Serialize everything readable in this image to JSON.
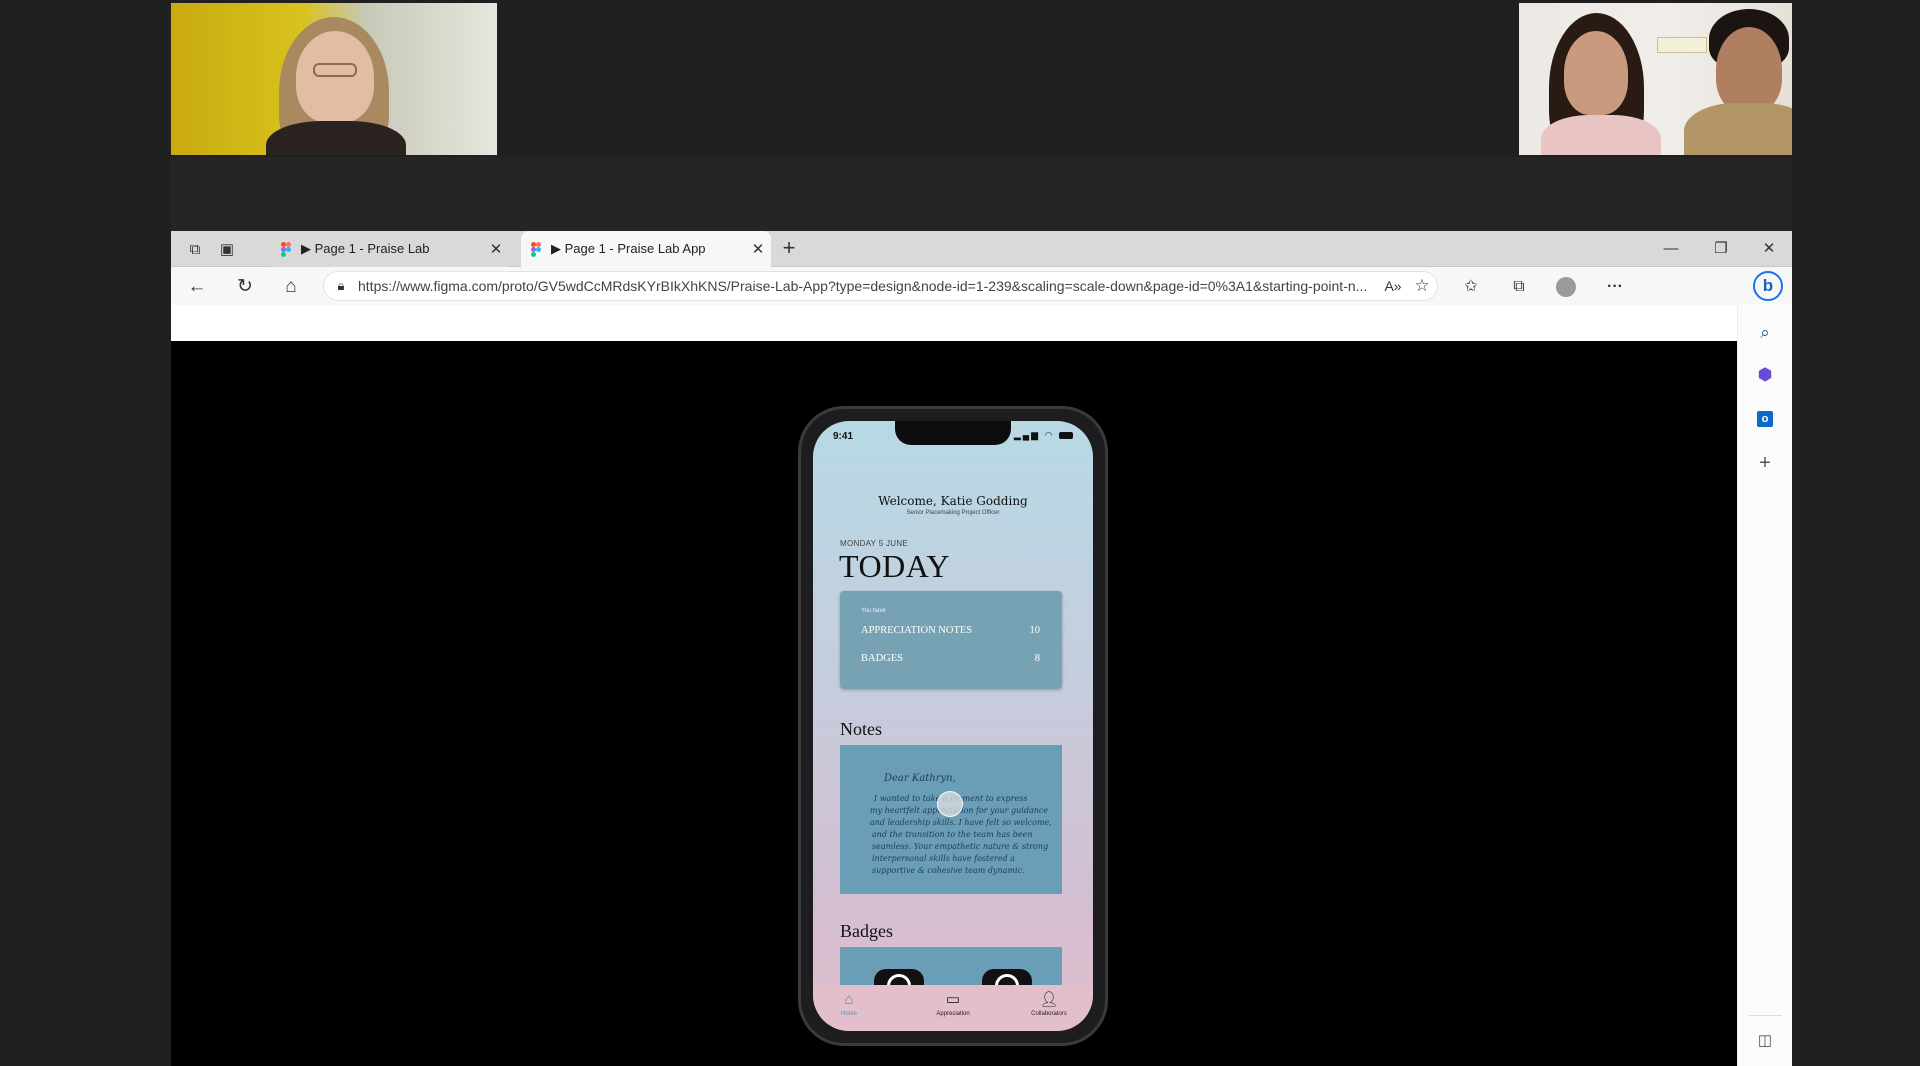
{
  "browser": {
    "tabs": [
      {
        "label": "▶ Page 1 - Praise Lab",
        "close": "✕"
      },
      {
        "label": "▶ Page 1 - Praise Lab App",
        "close": "✕"
      }
    ],
    "new_tab": "+",
    "window_controls": {
      "minimize": "—",
      "restore": "❐",
      "close": "✕"
    },
    "address": {
      "url": "https://www.figma.com/proto/GV5wdCcMRdsKYrBIkXhKNS/Praise-Lab-App?type=design&node-id=1-239&scaling=scale-down&page-id=0%3A1&starting-point-n..."
    },
    "icons": {
      "back": "back-icon",
      "refresh": "refresh-icon",
      "home": "home-icon",
      "lock": "lock-icon",
      "read_aloud": "read-aloud-icon",
      "favorite": "star-icon",
      "favorites": "favorites-icon",
      "collections": "collections-icon",
      "profile": "profile-icon",
      "more": "more-icon",
      "bing": "bing-icon"
    },
    "sidebar_icons": [
      "search-icon",
      "copilot-icon",
      "outlook-icon",
      "add-icon",
      "sidebar-toggle-icon"
    ],
    "bing_letter": "b"
  },
  "app": {
    "status_time": "9:41",
    "welcome": "Welcome, Katie Godding",
    "role": "Senior Placemaking Project Officer",
    "date": "MONDAY 5 JUNE",
    "today": "TODAY",
    "summary": {
      "intro": "You have",
      "rows": [
        {
          "label": "APPRECIATION NOTES",
          "value": "10"
        },
        {
          "label": "BADGES",
          "value": "8"
        }
      ]
    },
    "notes_title": "Notes",
    "note_lines": [
      "Dear Kathryn,",
      "I wanted to take a moment to express",
      "my heartfelt appreciation for your guidance",
      "and leadership skills. I have felt so welcome,",
      "and the transition to the team has been",
      "seamless. Your empathetic nature & strong",
      "interpersonal skills have fostered a",
      "supportive & cohesive team dynamic."
    ],
    "badges_title": "Badges",
    "tabbar": [
      {
        "label": "Home",
        "icon": "home-icon"
      },
      {
        "label": "Appreciation",
        "icon": "chat-icon"
      },
      {
        "label": "Collaborators",
        "icon": "person-icon"
      }
    ],
    "colors": {
      "accent_blue": "#6a9db6",
      "summary_card": "#77a2b4",
      "tab_active": "#5c8fb0"
    }
  }
}
